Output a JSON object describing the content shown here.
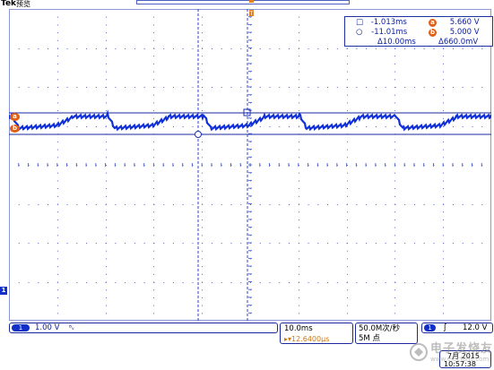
{
  "header": {
    "brand": "Tek",
    "mode": "预览"
  },
  "trigger_marker_label": "T",
  "readout": {
    "cursor1_time": "-1.013ms",
    "cursor2_time": "-11.01ms",
    "delta_time": "Δ10.00ms",
    "cursor_a_volt": "5.660 V",
    "cursor_b_volt": "5.000 V",
    "delta_volt": "Δ660.0mV",
    "badge_a": "a",
    "badge_b": "b"
  },
  "markers": {
    "a": "a",
    "b": "b",
    "ch1": "1"
  },
  "status": {
    "ch1_id": "1",
    "ch1_scale": "1.00 V",
    "ch1_bw": "ᴮᵥ",
    "timebase": "10.0ms",
    "trigger_delay": "▸▾12.6400μs",
    "sample_rate": "50.0M次/秒",
    "record_length": "5M 点",
    "trig_ch": "1",
    "trig_slope": "ʃ",
    "trig_level": "12.0 V",
    "date": "7月 2015",
    "time": "10:57:38"
  },
  "watermark": {
    "title": "电子发烧友",
    "sub": "www.elecfans.com"
  },
  "colors": {
    "trace": "#1030d8",
    "grid": "#5a6ad0",
    "accent": "#e06018"
  }
}
